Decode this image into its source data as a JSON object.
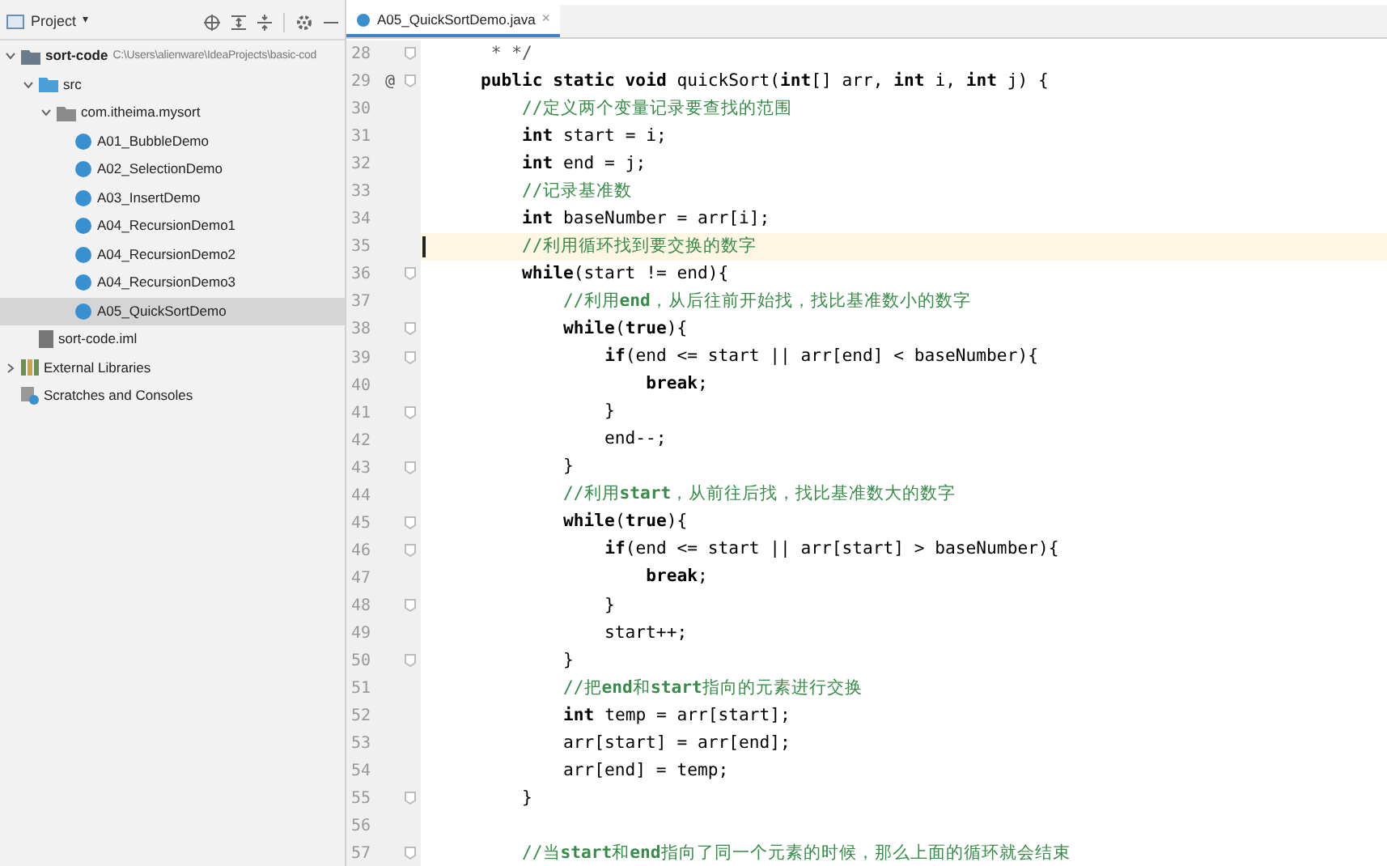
{
  "project_panel": {
    "title": "Project",
    "dropdown": "▾",
    "tree": [
      {
        "label": "sort-code",
        "path": "C:\\Users\\alienware\\IdeaProjects\\basic-cod",
        "kind": "module",
        "expanded": true,
        "selected": false,
        "children": [
          {
            "label": "src",
            "kind": "folder",
            "expanded": true,
            "selected": false,
            "children": [
              {
                "label": "com.itheima.mysort",
                "kind": "package",
                "expanded": true,
                "selected": false,
                "children": [
                  {
                    "label": "A01_BubbleDemo",
                    "kind": "class",
                    "selected": false
                  },
                  {
                    "label": "A02_SelectionDemo",
                    "kind": "class",
                    "selected": false
                  },
                  {
                    "label": "A03_InsertDemo",
                    "kind": "class",
                    "selected": false
                  },
                  {
                    "label": "A04_RecursionDemo1",
                    "kind": "class",
                    "selected": false
                  },
                  {
                    "label": "A04_RecursionDemo2",
                    "kind": "class",
                    "selected": false
                  },
                  {
                    "label": "A04_RecursionDemo3",
                    "kind": "class",
                    "selected": false
                  },
                  {
                    "label": "A05_QuickSortDemo",
                    "kind": "class",
                    "selected": true
                  }
                ]
              }
            ]
          },
          {
            "label": "sort-code.iml",
            "kind": "file",
            "selected": false
          }
        ]
      },
      {
        "label": "External Libraries",
        "kind": "library",
        "expanded": false,
        "selected": false
      },
      {
        "label": "Scratches and Consoles",
        "kind": "scratch",
        "selected": false
      }
    ]
  },
  "editor": {
    "tabs": [
      {
        "label": "A05_QuickSortDemo.java",
        "close": "×",
        "selected": true
      }
    ],
    "lines": [
      {
        "num": "28",
        "kind": "doc",
        "text": "     * */",
        "fold": true
      },
      {
        "num": "29",
        "kind": "code",
        "text": "    **public static void** quickSort(**int**[] arr, **int** i, **int** j) {",
        "marker": "@",
        "fold": true
      },
      {
        "num": "30",
        "kind": "comment",
        "text": "        //定义两个变量记录要查找的范围"
      },
      {
        "num": "31",
        "kind": "code",
        "text": "        **int** start = i;"
      },
      {
        "num": "32",
        "kind": "code",
        "text": "        **int** end = j;"
      },
      {
        "num": "33",
        "kind": "comment",
        "text": "        //记录基准数"
      },
      {
        "num": "34",
        "kind": "code",
        "text": "        **int** baseNumber = arr[i];"
      },
      {
        "num": "35",
        "kind": "comment",
        "text": "        //利用循环找到要交换的数字",
        "current": true
      },
      {
        "num": "36",
        "kind": "code",
        "text": "        **while**(start != end){",
        "fold": true
      },
      {
        "num": "37",
        "kind": "comment",
        "text": "            //利用**end**，从后往前开始找，找比基准数小的数字"
      },
      {
        "num": "38",
        "kind": "code",
        "text": "            **while**(**true**){",
        "fold": true
      },
      {
        "num": "39",
        "kind": "code",
        "text": "                **if**(end <= start || arr[end] < baseNumber){",
        "fold": true
      },
      {
        "num": "40",
        "kind": "code",
        "text": "                    **break**;"
      },
      {
        "num": "41",
        "kind": "code",
        "text": "                }",
        "fold": true
      },
      {
        "num": "42",
        "kind": "code",
        "text": "                end--;"
      },
      {
        "num": "43",
        "kind": "code",
        "text": "            }",
        "fold": true
      },
      {
        "num": "44",
        "kind": "comment",
        "text": "            //利用**start**，从前往后找，找比基准数大的数字"
      },
      {
        "num": "45",
        "kind": "code",
        "text": "            **while**(**true**){",
        "fold": true
      },
      {
        "num": "46",
        "kind": "code",
        "text": "                **if**(end <= start || arr[start] > baseNumber){",
        "fold": true
      },
      {
        "num": "47",
        "kind": "code",
        "text": "                    **break**;"
      },
      {
        "num": "48",
        "kind": "code",
        "text": "                }",
        "fold": true
      },
      {
        "num": "49",
        "kind": "code",
        "text": "                start++;"
      },
      {
        "num": "50",
        "kind": "code",
        "text": "            }",
        "fold": true
      },
      {
        "num": "51",
        "kind": "comment",
        "text": "            //把**end**和**start**指向的元素进行交换"
      },
      {
        "num": "52",
        "kind": "code",
        "text": "            **int** temp = arr[start];"
      },
      {
        "num": "53",
        "kind": "code",
        "text": "            arr[start] = arr[end];"
      },
      {
        "num": "54",
        "kind": "code",
        "text": "            arr[end] = temp;"
      },
      {
        "num": "55",
        "kind": "code",
        "text": "        }",
        "fold": true
      },
      {
        "num": "56"
      },
      {
        "num": "57",
        "kind": "comment",
        "text": "        //当**start**和**end**指向了同一个元素的时候，那么上面的循环就会结束",
        "fold": true
      }
    ]
  }
}
